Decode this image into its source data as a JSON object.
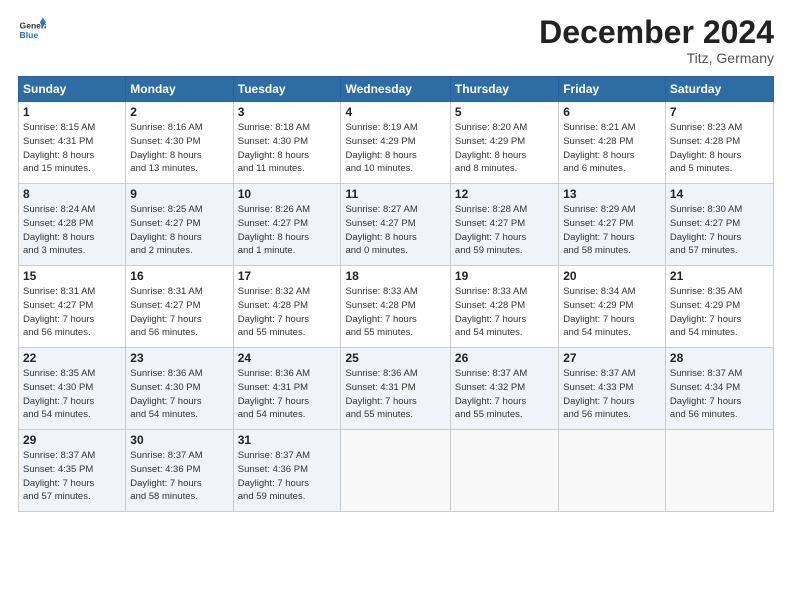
{
  "header": {
    "logo_line1": "General",
    "logo_line2": "Blue",
    "title": "December 2024",
    "subtitle": "Titz, Germany"
  },
  "columns": [
    "Sunday",
    "Monday",
    "Tuesday",
    "Wednesday",
    "Thursday",
    "Friday",
    "Saturday"
  ],
  "weeks": [
    [
      {
        "day": "1",
        "info": "Sunrise: 8:15 AM\nSunset: 4:31 PM\nDaylight: 8 hours\nand 15 minutes."
      },
      {
        "day": "2",
        "info": "Sunrise: 8:16 AM\nSunset: 4:30 PM\nDaylight: 8 hours\nand 13 minutes."
      },
      {
        "day": "3",
        "info": "Sunrise: 8:18 AM\nSunset: 4:30 PM\nDaylight: 8 hours\nand 11 minutes."
      },
      {
        "day": "4",
        "info": "Sunrise: 8:19 AM\nSunset: 4:29 PM\nDaylight: 8 hours\nand 10 minutes."
      },
      {
        "day": "5",
        "info": "Sunrise: 8:20 AM\nSunset: 4:29 PM\nDaylight: 8 hours\nand 8 minutes."
      },
      {
        "day": "6",
        "info": "Sunrise: 8:21 AM\nSunset: 4:28 PM\nDaylight: 8 hours\nand 6 minutes."
      },
      {
        "day": "7",
        "info": "Sunrise: 8:23 AM\nSunset: 4:28 PM\nDaylight: 8 hours\nand 5 minutes."
      }
    ],
    [
      {
        "day": "8",
        "info": "Sunrise: 8:24 AM\nSunset: 4:28 PM\nDaylight: 8 hours\nand 3 minutes."
      },
      {
        "day": "9",
        "info": "Sunrise: 8:25 AM\nSunset: 4:27 PM\nDaylight: 8 hours\nand 2 minutes."
      },
      {
        "day": "10",
        "info": "Sunrise: 8:26 AM\nSunset: 4:27 PM\nDaylight: 8 hours\nand 1 minute."
      },
      {
        "day": "11",
        "info": "Sunrise: 8:27 AM\nSunset: 4:27 PM\nDaylight: 8 hours\nand 0 minutes."
      },
      {
        "day": "12",
        "info": "Sunrise: 8:28 AM\nSunset: 4:27 PM\nDaylight: 7 hours\nand 59 minutes."
      },
      {
        "day": "13",
        "info": "Sunrise: 8:29 AM\nSunset: 4:27 PM\nDaylight: 7 hours\nand 58 minutes."
      },
      {
        "day": "14",
        "info": "Sunrise: 8:30 AM\nSunset: 4:27 PM\nDaylight: 7 hours\nand 57 minutes."
      }
    ],
    [
      {
        "day": "15",
        "info": "Sunrise: 8:31 AM\nSunset: 4:27 PM\nDaylight: 7 hours\nand 56 minutes."
      },
      {
        "day": "16",
        "info": "Sunrise: 8:31 AM\nSunset: 4:27 PM\nDaylight: 7 hours\nand 56 minutes."
      },
      {
        "day": "17",
        "info": "Sunrise: 8:32 AM\nSunset: 4:28 PM\nDaylight: 7 hours\nand 55 minutes."
      },
      {
        "day": "18",
        "info": "Sunrise: 8:33 AM\nSunset: 4:28 PM\nDaylight: 7 hours\nand 55 minutes."
      },
      {
        "day": "19",
        "info": "Sunrise: 8:33 AM\nSunset: 4:28 PM\nDaylight: 7 hours\nand 54 minutes."
      },
      {
        "day": "20",
        "info": "Sunrise: 8:34 AM\nSunset: 4:29 PM\nDaylight: 7 hours\nand 54 minutes."
      },
      {
        "day": "21",
        "info": "Sunrise: 8:35 AM\nSunset: 4:29 PM\nDaylight: 7 hours\nand 54 minutes."
      }
    ],
    [
      {
        "day": "22",
        "info": "Sunrise: 8:35 AM\nSunset: 4:30 PM\nDaylight: 7 hours\nand 54 minutes."
      },
      {
        "day": "23",
        "info": "Sunrise: 8:36 AM\nSunset: 4:30 PM\nDaylight: 7 hours\nand 54 minutes."
      },
      {
        "day": "24",
        "info": "Sunrise: 8:36 AM\nSunset: 4:31 PM\nDaylight: 7 hours\nand 54 minutes."
      },
      {
        "day": "25",
        "info": "Sunrise: 8:36 AM\nSunset: 4:31 PM\nDaylight: 7 hours\nand 55 minutes."
      },
      {
        "day": "26",
        "info": "Sunrise: 8:37 AM\nSunset: 4:32 PM\nDaylight: 7 hours\nand 55 minutes."
      },
      {
        "day": "27",
        "info": "Sunrise: 8:37 AM\nSunset: 4:33 PM\nDaylight: 7 hours\nand 56 minutes."
      },
      {
        "day": "28",
        "info": "Sunrise: 8:37 AM\nSunset: 4:34 PM\nDaylight: 7 hours\nand 56 minutes."
      }
    ],
    [
      {
        "day": "29",
        "info": "Sunrise: 8:37 AM\nSunset: 4:35 PM\nDaylight: 7 hours\nand 57 minutes."
      },
      {
        "day": "30",
        "info": "Sunrise: 8:37 AM\nSunset: 4:36 PM\nDaylight: 7 hours\nand 58 minutes."
      },
      {
        "day": "31",
        "info": "Sunrise: 8:37 AM\nSunset: 4:36 PM\nDaylight: 7 hours\nand 59 minutes."
      },
      null,
      null,
      null,
      null
    ]
  ]
}
